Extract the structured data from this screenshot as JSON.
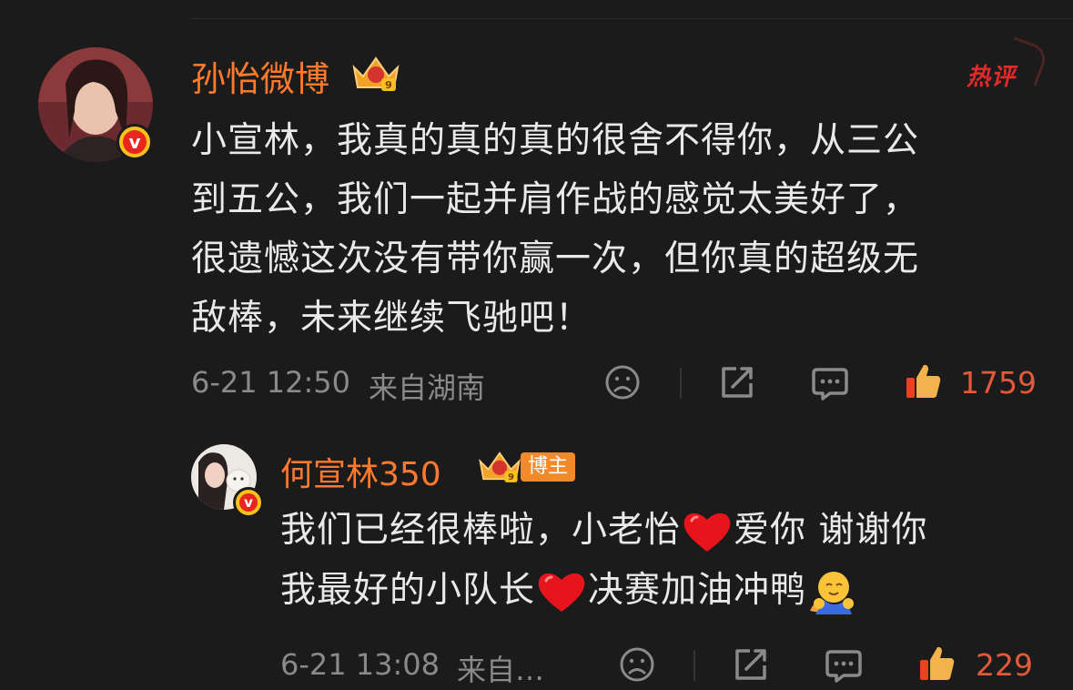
{
  "comment": {
    "author": "孙怡微博",
    "hot_label": "热评",
    "lines": [
      "小宣林，我真的真的真的很舍不得你，从三公",
      "到五公，我们一起并肩作战的感觉太美好了，",
      "很遗憾这次没有带你赢一次，但你真的超级无",
      "敌棒，未来继续飞驰吧！"
    ],
    "time": "6-21 12:50",
    "location": "来自湖南",
    "likes": "1759"
  },
  "reply": {
    "author": "何宣林350",
    "badge_label": "博主",
    "line1_a": "我们已经很棒啦，小老怡",
    "line1_b": "爱你 谢谢你",
    "line2_a": "我最好的小队长",
    "line2_b": "决赛加油冲鸭",
    "time": "6-21 13:08",
    "location": "来自…",
    "likes": "229"
  },
  "colors": {
    "background": "#1b1b1b",
    "name": "#ff7a2e",
    "likes": "#e35a3a",
    "hot": "#e22a2a",
    "meta": "#8a8a8a"
  },
  "icons": [
    "verified-v-icon",
    "crown-level-icon",
    "dislike-face-icon",
    "share-icon",
    "comment-icon",
    "like-thumb-icon",
    "heart-emoji",
    "hug-emoji"
  ]
}
